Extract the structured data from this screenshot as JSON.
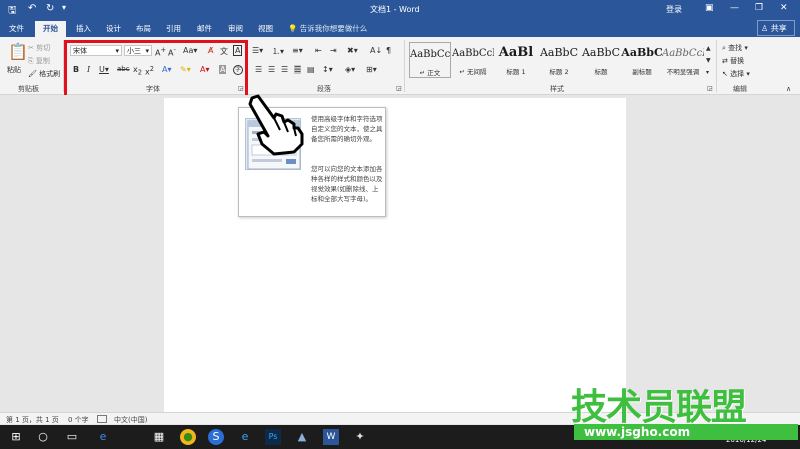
{
  "titlebar": {
    "title": "文档1 - Word",
    "login": "登录"
  },
  "tabs": [
    "文件",
    "开始",
    "插入",
    "设计",
    "布局",
    "引用",
    "邮件",
    "审阅",
    "视图"
  ],
  "tell_me": "告诉我你想要做什么",
  "share": "共享",
  "clipboard": {
    "paste": "粘贴",
    "cut": "剪切",
    "copy": "复制",
    "format_painter": "格式刷",
    "group_label": "剪贴板"
  },
  "font": {
    "name": "宋体",
    "size": "小三",
    "group_label": "字体"
  },
  "paragraph": {
    "group_label": "段落"
  },
  "styles": {
    "group_label": "样式",
    "items": [
      {
        "sample": "AaBbCcDd",
        "name": "↵ 正文"
      },
      {
        "sample": "AaBbCcDd",
        "name": "↵ 无间隔"
      },
      {
        "sample": "AaBl",
        "name": "标题 1"
      },
      {
        "sample": "AaBbC",
        "name": "标题 2"
      },
      {
        "sample": "AaBbC",
        "name": "标题"
      },
      {
        "sample": "AaBbC",
        "name": "副标题"
      },
      {
        "sample": "AaBbCcDd",
        "name": "不明显强调"
      }
    ]
  },
  "editing": {
    "find": "查找",
    "replace": "替换",
    "select": "选择",
    "group_label": "编辑"
  },
  "tooltip": {
    "line1": "使用高级字体和字符选项自定义您的文本，使之具备您所需的确切外观。",
    "line2": "您可以向您的文本添加各种各样的样式和颜色以及视觉效果(如删除线、上标和全部大写字母)。"
  },
  "status": {
    "page": "第 1 页，共 1 页",
    "words": "0 个字",
    "lang": "中文(中国)"
  },
  "watermark": {
    "big": "技术员联盟",
    "small": "www.jsgho.com"
  },
  "clock": "2016/12/24"
}
